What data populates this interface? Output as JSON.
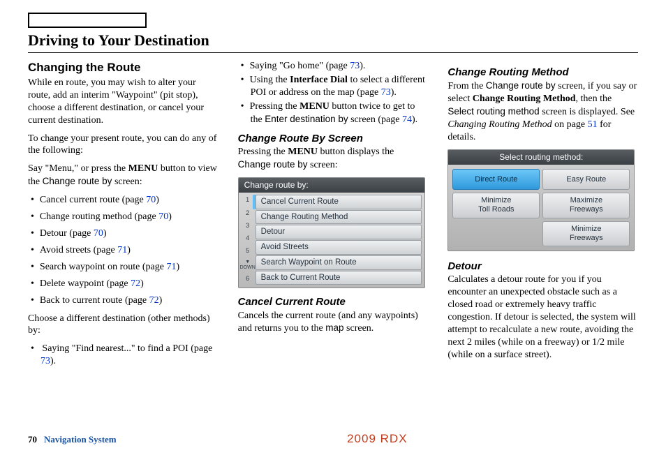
{
  "chapter_title": "Driving to Your Destination",
  "col1": {
    "section_title": "Changing the Route",
    "intro1": "While en route, you may wish to alter your route, add an interim \"Waypoint\" (pit stop), choose a different destination, or cancel your current destination.",
    "intro2": "To change your present route, you can do any of the following:",
    "lead1_a": "Say \"Menu,\" or press the ",
    "menu_word": "MENU",
    "lead1_b": " button to view the ",
    "change_route_by": "Change route by",
    "lead1_c": " screen:",
    "list": [
      {
        "t": "Cancel current route (page ",
        "p": "70",
        "e": ")"
      },
      {
        "t": "Change routing method (page ",
        "p": "70",
        "e": ")"
      },
      {
        "t": "Detour (page ",
        "p": "70",
        "e": ")"
      },
      {
        "t": "Avoid streets (page ",
        "p": "71",
        "e": ")"
      },
      {
        "t": "Search waypoint on route (page ",
        "p": "71",
        "e": ")"
      },
      {
        "t": "Delete waypoint (page ",
        "p": "72",
        "e": ")"
      },
      {
        "t": "Back to current route (page ",
        "p": "72",
        "e": ")"
      }
    ],
    "other_methods": "Choose a different destination (other methods) by:",
    "find_nearest": {
      "t": "Saying \"Find nearest...\" to find a POI (page ",
      "p": "73",
      "e": ")."
    }
  },
  "col2": {
    "cont_list": [
      {
        "t": "Saying \"Go home\" (page ",
        "p": "73",
        "e": ")."
      },
      {
        "pre": "Using the ",
        "b": "Interface Dial",
        "post": " to select a different POI or address on the map (page ",
        "p": "73",
        "e": ")."
      },
      {
        "pre": "Pressing the ",
        "b": "MENU",
        "post": " button twice to get to the ",
        "sans": "Enter destination by",
        "post2": " screen (page ",
        "p": "74",
        "e": ")."
      }
    ],
    "sub1_title": "Change Route By Screen",
    "sub1_a": "Pressing the ",
    "sub1_b": " button displays the ",
    "sub1_c": " screen:",
    "screen1": {
      "title": "Change route by:",
      "rows": [
        "Cancel Current Route",
        "Change Routing Method",
        "Detour",
        "Avoid Streets",
        "Search Waypoint on Route",
        "Back to Current Route"
      ],
      "nums": [
        "1",
        "2",
        "3",
        "4",
        "5",
        "6"
      ],
      "down": "DOWN"
    },
    "sub2_title": "Cancel Current Route",
    "sub2_a": "Cancels the current route (and any waypoints) and returns you to the ",
    "map_word": "map",
    "sub2_b": " screen."
  },
  "col3": {
    "sub1_title": "Change Routing Method",
    "p1_a": "From the ",
    "p1_b": " screen, if you say or select ",
    "bold1": "Change Routing Method",
    "p1_c": ", then the ",
    "sans1": "Select routing method",
    "p1_d": " screen is displayed. See ",
    "ital1": "Changing Routing Method",
    "p1_e": " on page ",
    "p1_page": "51",
    "p1_f": " for details.",
    "screen2": {
      "title": "Select routing method:",
      "cells": [
        "Direct Route",
        "Easy Route",
        "Minimize\nToll Roads",
        "Maximize\nFreeways",
        "",
        "Minimize\nFreeways"
      ]
    },
    "sub2_title": "Detour",
    "p2": "Calculates a detour route for you if you encounter an unexpected obstacle such as a closed road or extremely heavy traffic congestion. If detour is selected, the system will attempt to recalculate a new route, avoiding the next 2 miles (while on a freeway) or 1/2 mile (while on a surface street)."
  },
  "footer": {
    "page": "70",
    "section": "Navigation System",
    "model": "2009 RDX"
  }
}
